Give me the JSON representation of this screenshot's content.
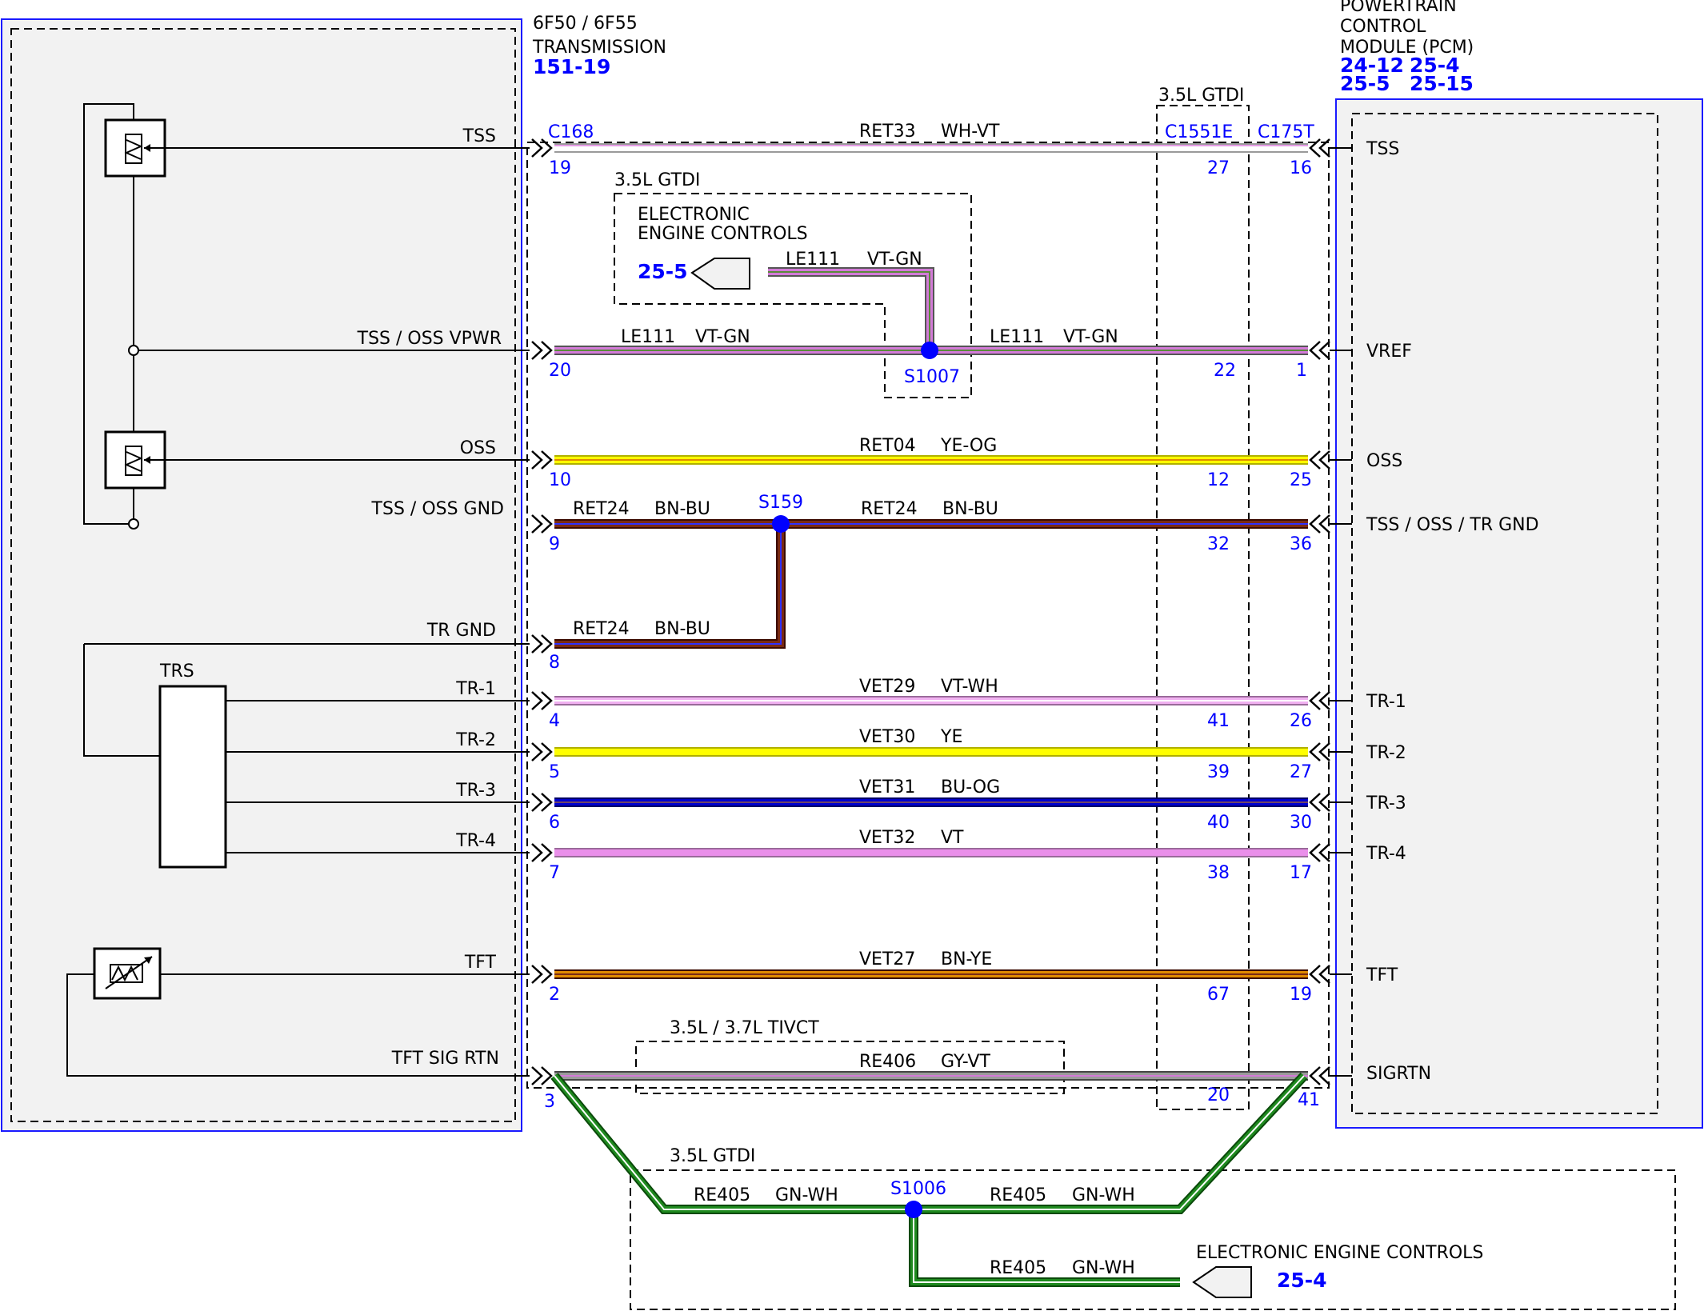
{
  "title_block": {
    "transmission": {
      "line1": "6F50 / 6F55",
      "line2": "TRANSMISSION",
      "ref": "151-19"
    },
    "pcm": {
      "line1": "POWERTRAIN",
      "line2": "CONTROL",
      "line3": "MODULE (PCM)",
      "refs": [
        "24-12",
        "25-4",
        "25-5",
        "25-15"
      ]
    }
  },
  "connectors": {
    "trans": "C168",
    "inline": "C1551E",
    "pcm": "C175T"
  },
  "option_notes": {
    "inline_gtdi": "3.5L GTDI",
    "eec_gtdi": "3.5L GTDI",
    "tivct": "3.5L / 3.7L TIVCT",
    "bottom_gtdi": "3.5L GTDI"
  },
  "splices": {
    "s1007": "S1007",
    "s159": "S159",
    "s1006": "S1006"
  },
  "components": {
    "trs": "TRS"
  },
  "eec_top": {
    "line1": "ELECTRONIC",
    "line2": "ENGINE CONTROLS",
    "ref": "25-5",
    "circuit": "LE111",
    "color": "VT-GN"
  },
  "eec_bottom": {
    "label": "ELECTRONIC ENGINE CONTROLS",
    "ref": "25-4",
    "circuit": "RE405",
    "color": "GN-WH"
  },
  "circuits": [
    {
      "id": "tss",
      "left_label": "TSS",
      "right_label": "TSS",
      "circuit": "RET33",
      "color": "WH-VT",
      "pin_trans": "19",
      "pin_inline": "27",
      "pin_pcm": "16"
    },
    {
      "id": "vref",
      "left_label": "TSS / OSS VPWR",
      "right_label": "VREF",
      "circuit": "LE111",
      "color": "VT-GN",
      "pin_trans": "20",
      "pin_inline": "22",
      "pin_pcm": "1"
    },
    {
      "id": "oss",
      "left_label": "OSS",
      "right_label": "OSS",
      "circuit": "RET04",
      "color": "YE-OG",
      "pin_trans": "10",
      "pin_inline": "12",
      "pin_pcm": "25"
    },
    {
      "id": "gnd",
      "left_label": "TSS / OSS GND",
      "right_label": "TSS / OSS / TR GND",
      "circuit": "RET24",
      "color": "BN-BU",
      "pin_trans": "9",
      "pin_inline": "32",
      "pin_pcm": "36"
    },
    {
      "id": "trgnd",
      "left_label": "TR GND",
      "circuit": "RET24",
      "color": "BN-BU",
      "pin_trans": "8"
    },
    {
      "id": "tr1",
      "left_label": "TR-1",
      "right_label": "TR-1",
      "circuit": "VET29",
      "color": "VT-WH",
      "pin_trans": "4",
      "pin_inline": "41",
      "pin_pcm": "26"
    },
    {
      "id": "tr2",
      "left_label": "TR-2",
      "right_label": "TR-2",
      "circuit": "VET30",
      "color": "YE",
      "pin_trans": "5",
      "pin_inline": "39",
      "pin_pcm": "27"
    },
    {
      "id": "tr3",
      "left_label": "TR-3",
      "right_label": "TR-3",
      "circuit": "VET31",
      "color": "BU-OG",
      "pin_trans": "6",
      "pin_inline": "40",
      "pin_pcm": "30"
    },
    {
      "id": "tr4",
      "left_label": "TR-4",
      "right_label": "TR-4",
      "circuit": "VET32",
      "color": "VT",
      "pin_trans": "7",
      "pin_inline": "38",
      "pin_pcm": "17"
    },
    {
      "id": "tft",
      "left_label": "TFT",
      "right_label": "TFT",
      "circuit": "VET27",
      "color": "BN-YE",
      "pin_trans": "2",
      "pin_inline": "67",
      "pin_pcm": "19"
    },
    {
      "id": "sigrtn",
      "left_label": "TFT SIG RTN",
      "right_label": "SIGRTN",
      "circuit": "RE406",
      "color": "GY-VT",
      "pin_trans": "3",
      "pin_inline": "20",
      "pin_pcm": "41"
    },
    {
      "id": "re405",
      "circuit": "RE405",
      "color": "GN-WH"
    }
  ],
  "wire_colors": {
    "white": "#ffffff",
    "violet": "#d37ad8",
    "violet_light": "#f0b0f0",
    "green": "#1f8a1f",
    "yellow": "#ffff00",
    "orange": "#e08a00",
    "brown": "#7a2a14",
    "blue": "#0000cc",
    "gray": "#9a9a9a",
    "accent_blue": "#0000ff",
    "panel": "#f2f2f2"
  }
}
